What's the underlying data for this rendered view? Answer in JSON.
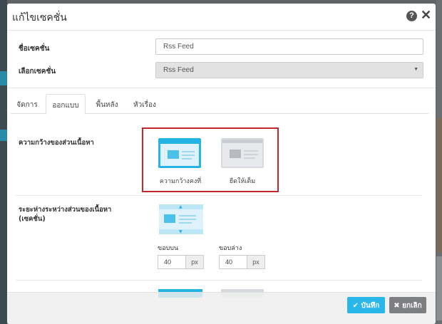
{
  "modal": {
    "title": "แก้ไขเซคชั่น"
  },
  "form": {
    "section_name_label": "ชื่อเซคชั่น",
    "section_name_value": "Rss Feed",
    "select_section_label": "เลือกเซคชั่น",
    "select_section_value": "Rss Feed"
  },
  "tabs": [
    {
      "label": "จัดการ",
      "active": false
    },
    {
      "label": "ออกแบบ",
      "active": true
    },
    {
      "label": "พื้นหลัง",
      "active": false
    },
    {
      "label": "หัวเรื่อง",
      "active": false
    }
  ],
  "content_width": {
    "label": "ความกว้างของส่วนเนื้อหา",
    "options": [
      {
        "label": "ความกว้างคงที่",
        "selected": true,
        "icon": "fixed-width-layout-icon"
      },
      {
        "label": "ยืดให้เต็ม",
        "selected": false,
        "icon": "full-width-layout-icon"
      }
    ]
  },
  "spacing": {
    "label_line1": "ระยะห่างระหว่างส่วนของเนื้อหา",
    "label_line2": "(เซคชั่น)",
    "top_label": "ขอบบน",
    "top_value": "40",
    "top_unit": "px",
    "bottom_label": "ขอบล่าง",
    "bottom_value": "40",
    "bottom_unit": "px"
  },
  "footer": {
    "save_label": "บันทึก",
    "cancel_label": "ยกเลิก"
  },
  "colors": {
    "accent": "#29b6e8",
    "highlight": "#c0282d",
    "cancel": "#7d7f82"
  }
}
